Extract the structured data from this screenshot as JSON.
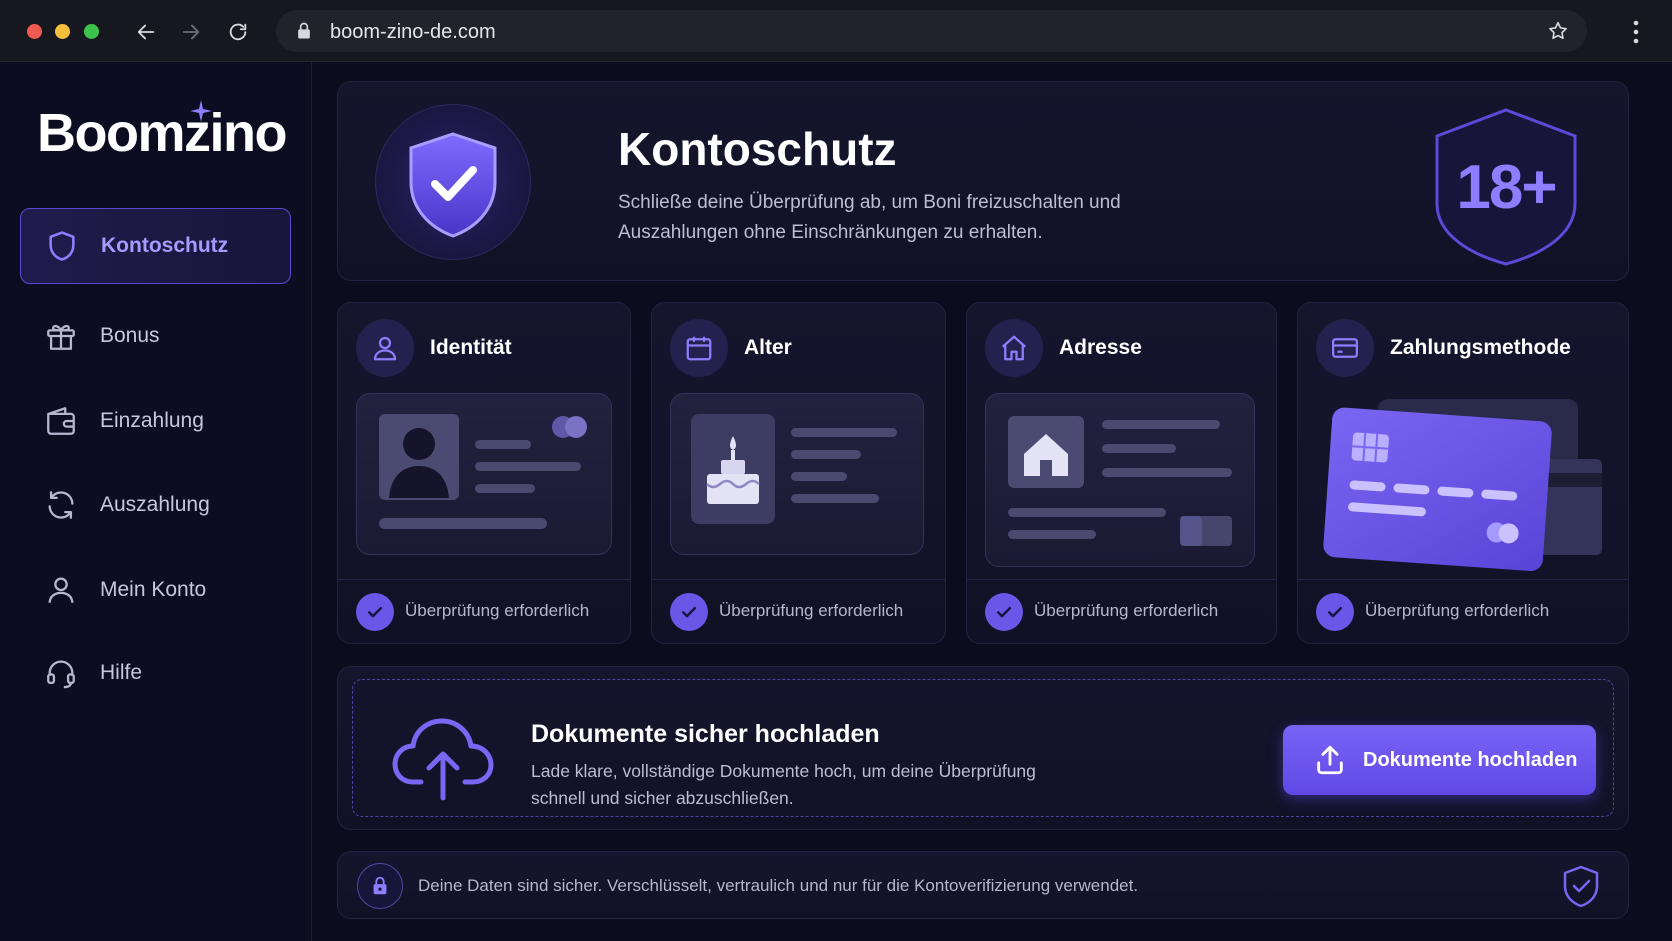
{
  "browser": {
    "url": "boom-zino-de.com"
  },
  "sidebar": {
    "logo": "Boomzino",
    "items": [
      {
        "label": "Kontoschutz",
        "icon": "shield-icon",
        "active": true
      },
      {
        "label": "Bonus",
        "icon": "gift-icon",
        "active": false
      },
      {
        "label": "Einzahlung",
        "icon": "wallet-icon",
        "active": false
      },
      {
        "label": "Auszahlung",
        "icon": "refresh-icon",
        "active": false
      },
      {
        "label": "Mein Konto",
        "icon": "user-icon",
        "active": false
      },
      {
        "label": "Hilfe",
        "icon": "headset-icon",
        "active": false
      }
    ]
  },
  "hero": {
    "title": "Kontoschutz",
    "description": "Schließe deine Überprüfung ab, um Boni freizuschalten und Auszahlungen ohne Einschränkungen zu erhalten.",
    "badge": "18+"
  },
  "cards": [
    {
      "title": "Identität",
      "icon": "user-icon",
      "status": "Überprüfung erforderlich"
    },
    {
      "title": "Alter",
      "icon": "calendar-icon",
      "status": "Überprüfung erforderlich"
    },
    {
      "title": "Adresse",
      "icon": "home-icon",
      "status": "Überprüfung erforderlich"
    },
    {
      "title": "Zahlungsmethode",
      "icon": "credit-card-icon",
      "status": "Überprüfung erforderlich"
    }
  ],
  "upload": {
    "title": "Dokumente sicher hochladen",
    "description": "Lade klare, vollständige Dokumente hoch, um deine Überprüfung schnell und sicher abzuschließen.",
    "button_label": "Dokumente hochladen"
  },
  "security": {
    "text": "Deine Daten sind sicher. Verschlüsselt, vertraulich und nur für die Kontoverifizierung verwendet."
  },
  "colors": {
    "accent": "#6b56e8",
    "active_nav": "#a59bff",
    "background": "#0c0c1e"
  }
}
